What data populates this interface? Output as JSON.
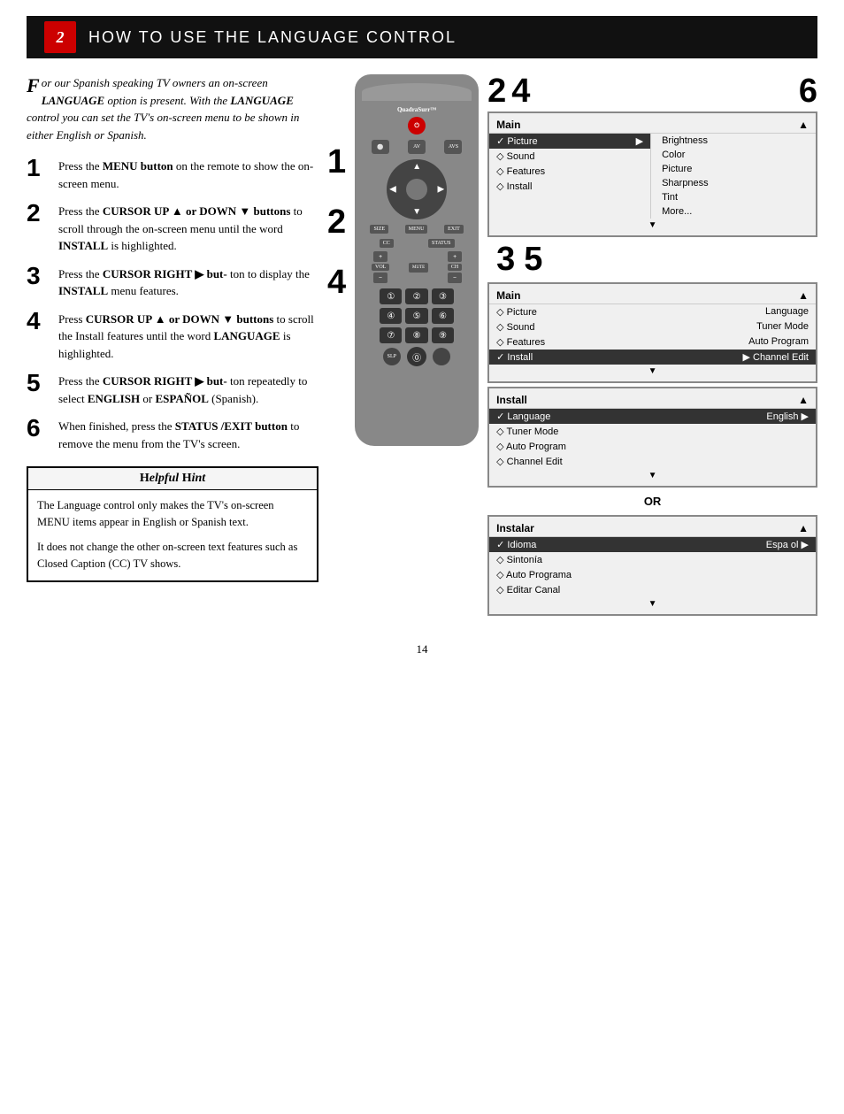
{
  "header": {
    "icon_text": "2",
    "title_part1": "How to Use the ",
    "title_part2": "Language Control"
  },
  "intro": {
    "text": "or our Spanish speaking TV owners an on-screen LANGUAGE option is present. With the LANGUAGE control you can set the TV's on-screen menu to be shown in either English or Spanish."
  },
  "steps": [
    {
      "number": "1",
      "text_html": "Press the <strong>MENU button</strong> on the remote to show the on-screen menu."
    },
    {
      "number": "2",
      "text_html": "Press the <strong>CURSOR UP ▲ or DOWN ▼ buttons</strong> to scroll through the on-screen menu until the word <strong>INSTALL</strong> is highlighted."
    },
    {
      "number": "3",
      "text_html": "Press the <strong>CURSOR RIGHT ▶ but-</strong> ton to display the <strong>INSTALL</strong> menu features."
    },
    {
      "number": "4",
      "text_html": "Press <strong>CURSOR UP ▲ or DOWN ▼ buttons</strong> to scroll the Install features until the word <strong>LANGUAGE</strong> is highlighted."
    },
    {
      "number": "5",
      "text_html": "Press the <strong>CURSOR RIGHT ▶ but-</strong> ton repeatedly to select <strong>ENGLISH</strong> or <strong>ESPAÑOL</strong> (Spanish)."
    },
    {
      "number": "6",
      "text_html": "When finished, press the <strong>STATUS /EXIT button</strong> to remove the menu from the TV's screen."
    }
  ],
  "hint": {
    "title": "Helpful Hint",
    "paragraphs": [
      "The Language control only makes the TV's on-screen MENU items appear in English or Spanish text.",
      "It does not change the other on-screen text features such as Closed Caption (CC) TV shows."
    ]
  },
  "menu_main": {
    "title": "Main",
    "items": [
      {
        "left": "✓ Picture",
        "right": "▶",
        "sub": "Brightness",
        "highlighted": false
      },
      {
        "left": "◇ Sound",
        "right": "",
        "sub": "Color",
        "highlighted": false
      },
      {
        "left": "◇ Features",
        "right": "",
        "sub": "Picture",
        "highlighted": false
      },
      {
        "left": "◇ Install",
        "right": "",
        "sub": "Sharpness",
        "highlighted": false
      },
      {
        "left": "",
        "right": "",
        "sub": "Tint",
        "highlighted": false
      },
      {
        "left": "",
        "right": "",
        "sub": "More...",
        "highlighted": false
      }
    ]
  },
  "menu_install_english": {
    "title": "Main",
    "items": [
      {
        "left": "◇ Picture",
        "right": "Language",
        "highlighted": false
      },
      {
        "left": "◇ Sound",
        "right": "Tuner Mode",
        "highlighted": false
      },
      {
        "left": "◇ Features",
        "right": "Auto Program",
        "highlighted": false
      },
      {
        "left": "✓ Install",
        "right": "▶  Channel Edit",
        "highlighted": true
      }
    ]
  },
  "menu_install_panel": {
    "title": "Install",
    "items": [
      {
        "left": "✓ Language",
        "right": "English ▶",
        "highlighted": true
      },
      {
        "left": "◇ Tuner Mode",
        "right": "",
        "highlighted": false
      },
      {
        "left": "◇ Auto Program",
        "right": "",
        "highlighted": false
      },
      {
        "left": "◇ Channel Edit",
        "right": "",
        "highlighted": false
      }
    ]
  },
  "menu_install_spanish": {
    "title": "Instalar",
    "items": [
      {
        "left": "✓ Idioma",
        "right": "Espa ol ▶",
        "highlighted": true
      },
      {
        "left": "◇ Sintonía",
        "right": "",
        "highlighted": false
      },
      {
        "left": "◇ Auto Programa",
        "right": "",
        "highlighted": false
      },
      {
        "left": "◇ Editar Canal",
        "right": "",
        "highlighted": false
      }
    ]
  },
  "or_label": "OR",
  "diagram_step_nums_left": [
    "1",
    "2",
    "4"
  ],
  "diagram_step_nums_right": [
    "2",
    "4",
    "6",
    "3",
    "5"
  ],
  "page_number": "14",
  "remote": {
    "brand": "QuadraSurr™",
    "power_label": "POWER",
    "menu_label": "MENU",
    "exit_label": "EXIT",
    "mute_label": "MUTE",
    "sleep_label": "SLEEP",
    "cc_label": "CC",
    "status_label": "STATUS",
    "ch_label": "CH",
    "vol_label": "VOL",
    "numbers": [
      "1",
      "2",
      "3",
      "4",
      "5",
      "6",
      "7",
      "8",
      "9",
      "0"
    ]
  }
}
